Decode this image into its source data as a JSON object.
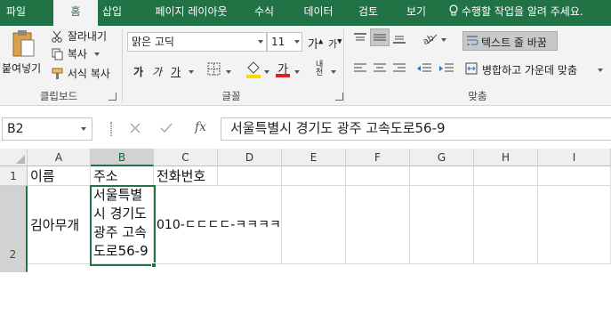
{
  "tabs": [
    {
      "label": "파일"
    },
    {
      "label": "홈"
    },
    {
      "label": "삽입"
    },
    {
      "label": "페이지 레이아웃"
    },
    {
      "label": "수식"
    },
    {
      "label": "데이터"
    },
    {
      "label": "검토"
    },
    {
      "label": "보기"
    }
  ],
  "tell_me": "수행할 작업을 알려 주세요.",
  "clipboard": {
    "paste": "붙여넣기",
    "cut": "잘라내기",
    "copy": "복사",
    "format_painter": "서식 복사",
    "label": "클립보드"
  },
  "font": {
    "name": "맑은 고딕",
    "size": "11",
    "grow": "가",
    "shrink": "가",
    "bold": "가",
    "italic": "가",
    "underline": "가",
    "color_glyph": "가",
    "phonetic": "내천",
    "label": "글꼴",
    "fill_color": "#ffd700",
    "font_color": "#e02020"
  },
  "alignment": {
    "wrap_text": "텍스트 줄 바꿈",
    "merge_center": "병합하고 가운데 맞춤",
    "label": "맞춤"
  },
  "formula_bar": {
    "name_box": "B2",
    "fx": "fx",
    "content": "서울특별시 경기도 광주 고속도로56-9"
  },
  "columns": [
    "A",
    "B",
    "C",
    "D",
    "E",
    "F",
    "G",
    "H",
    "I"
  ],
  "rows": [
    "1",
    "2"
  ],
  "cells": {
    "A1": "이름",
    "B1": "주소",
    "C1": "전화번호",
    "A2": "김아무개",
    "B2_lines": [
      "서울특별",
      "시 경기도",
      "광주 고속",
      "도로56-9"
    ],
    "C2": "010-ㄷㄷㄷㄷ-ㅋㅋㅋㅋ"
  },
  "colors": {
    "accent": "#217346"
  }
}
